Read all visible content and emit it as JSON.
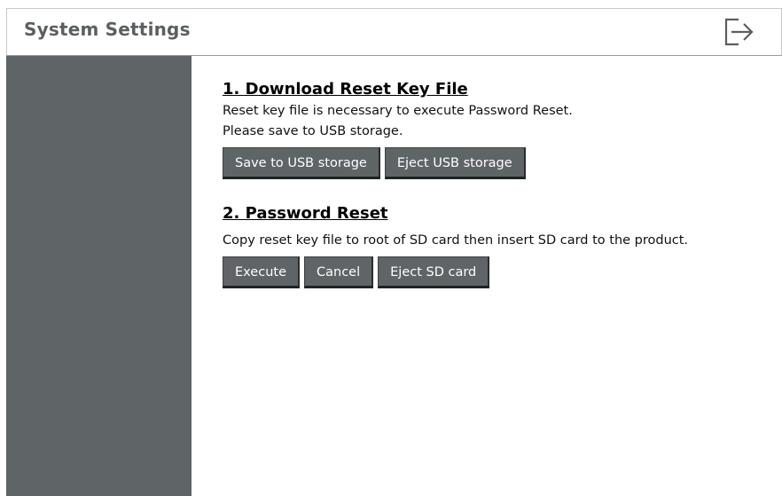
{
  "header": {
    "title": "System Settings",
    "logout_icon": "logout-icon"
  },
  "section1": {
    "title": "1. Download Reset Key File",
    "line1": "Reset key file is necessary to execute Password Reset.",
    "line2": "Please save to USB storage.",
    "save_usb_label": "Save to USB storage",
    "eject_usb_label": "Eject USB storage"
  },
  "section2": {
    "title": "2. Password Reset",
    "line1": "Copy reset key file to root of SD card then insert SD card to the product.",
    "execute_label": "Execute",
    "cancel_label": "Cancel",
    "eject_sd_label": "Eject SD card"
  },
  "colors": {
    "sidebar": "#5f6466",
    "button": "#5f6466",
    "header_title": "#5b5f61"
  }
}
